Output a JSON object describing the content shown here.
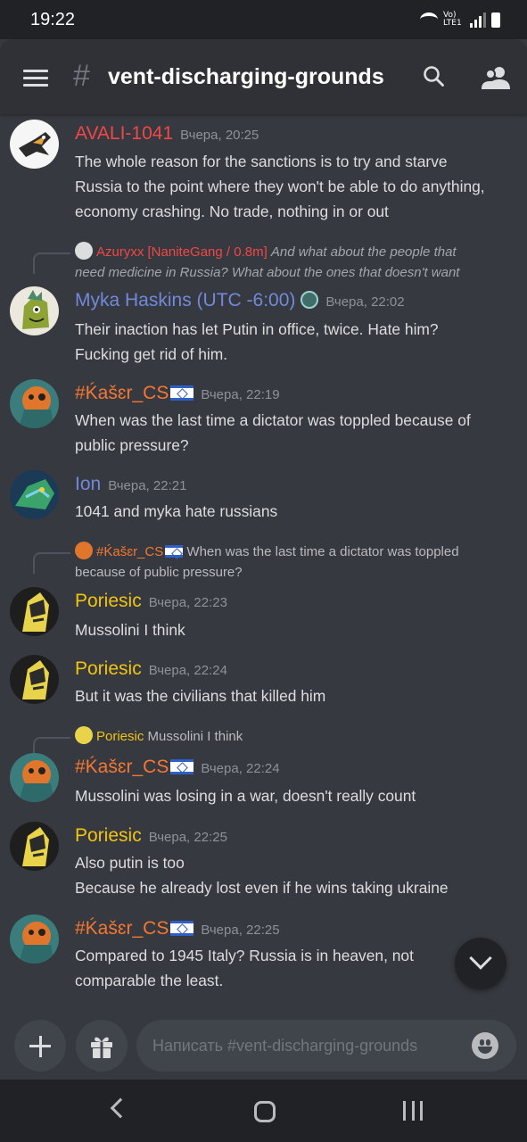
{
  "status": {
    "time": "19:22",
    "network": "Vo) LTE1"
  },
  "header": {
    "channel": "vent-discharging-grounds",
    "hash": "#"
  },
  "colors": {
    "avali": "#f04747",
    "azuryxx": "#f04747",
    "myka": "#7289da",
    "kaser": "#f57731",
    "ion": "#7289da",
    "poriesic": "#f1c40f"
  },
  "messages": [
    {
      "author": "AVALI-1041",
      "time": "Вчера, 20:25",
      "lines": [
        "The whole reason for the sanctions is to try and starve",
        "Russia to the point where they won't be able to do anything,",
        "economy crashing. No trade, nothing in or out"
      ]
    },
    {
      "reply": {
        "author": "Azuryxx [NaniteGang / 0.8m]",
        "line1": "And what about the people that",
        "line2": "need medicine in Russia? What about the ones that doesn't want"
      },
      "author": "Myka Haskins (UTC -6:00)",
      "time": "Вчера, 22:02",
      "lines": [
        "Their  inaction has let Putin in office, twice. Hate him?",
        "Fucking get rid of him."
      ]
    },
    {
      "author": "#Ḱašɛr_CS",
      "time": "Вчера, 22:19",
      "lines": [
        "When was the last time a dictator was toppled because of",
        "public pressure?"
      ]
    },
    {
      "author": "Ion",
      "time": "Вчера, 22:21",
      "lines": [
        "1041 and myka hate russians"
      ]
    },
    {
      "reply": {
        "author": "#Ḱašɛr_CS",
        "line1": "When was the last time a dictator was toppled",
        "line2": "because of public pressure?"
      },
      "author": "Poriesic",
      "time": "Вчера, 22:23",
      "lines": [
        "Mussolini I think"
      ]
    },
    {
      "author": "Poriesic",
      "time": "Вчера, 22:24",
      "lines": [
        "But it was the civilians that killed him"
      ]
    },
    {
      "reply": {
        "author": "Poriesic",
        "line1": "Mussolini I think"
      },
      "author": "#Ḱašɛr_CS",
      "time": "Вчера, 22:24",
      "lines": [
        "Mussolini was losing in a war, doesn't really count"
      ]
    },
    {
      "author": "Poriesic",
      "time": "Вчера, 22:25",
      "lines": [
        "Also putin is too",
        "Because he already lost even if he wins taking ukraine"
      ]
    },
    {
      "author": "#Ḱašɛr_CS",
      "time": "Вчера, 22:25",
      "lines": [
        "Compared to 1945 Italy? Russia is in heaven, not",
        "comparable the least."
      ]
    }
  ],
  "composer": {
    "placeholder": "Написать #vent-discharging-grounds"
  }
}
